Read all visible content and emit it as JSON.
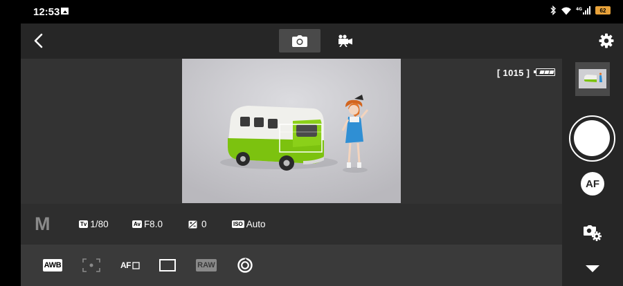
{
  "status_bar": {
    "time": "12:53",
    "battery": "62",
    "icons": [
      "gallery-icon",
      "bluetooth-icon",
      "wifi-icon",
      "signal-icon",
      "battery-icon"
    ]
  },
  "top_bar": {
    "icons": [
      "back-arrow-icon",
      "camera-icon",
      "video-camera-icon",
      "gear-icon"
    ],
    "selected_mode": "photo"
  },
  "live_view": {
    "shots_remaining": "[ 1015 ]",
    "battery_icon": "camera-battery-full-icon"
  },
  "exposure": {
    "mode": "M",
    "tv_badge": "Tv",
    "shutter": "1/80",
    "av_badge": "Av",
    "aperture": "F8.0",
    "exposure_comp": "0",
    "iso_badge": "ISO",
    "iso": "Auto"
  },
  "tools": {
    "awb": "AWB",
    "af_mode": "AF",
    "raw": "RAW",
    "icons": [
      "metering-icon",
      "af-frame-icon",
      "aspect-ratio-icon",
      "image-quality-icon",
      "drive-icon"
    ]
  },
  "right_col": {
    "af_label": "AF",
    "icons": [
      "thumbnail",
      "shutter-button",
      "camera-settings-icon",
      "chevron-down-icon"
    ]
  },
  "colors": {
    "accent_battery": "#e8a23a",
    "background": "#333333",
    "toolbar": "#262626"
  }
}
